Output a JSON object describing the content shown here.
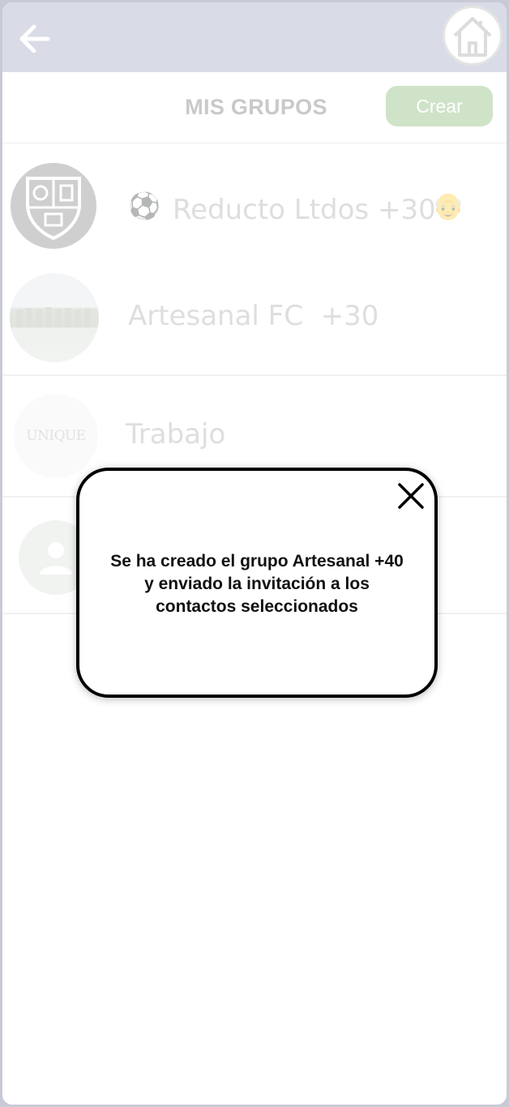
{
  "header": {
    "back_icon": "arrow-left-icon",
    "home_icon": "home-icon"
  },
  "title": "MIS GRUPOS",
  "create_button": "Crear",
  "groups": [
    {
      "name": "Reducto Ltdos +30",
      "leading_emoji": "⚽",
      "trailing_emoji": "👴",
      "avatar": "crest-logo"
    },
    {
      "name": "Artesanal FC  +30",
      "avatar": "team-photo"
    },
    {
      "name": "Trabajo",
      "avatar": "unique-logo",
      "avatar_text": "UNIQUE"
    },
    {
      "name": "",
      "avatar": "default-group-avatar"
    }
  ],
  "modal": {
    "message": "Se ha creado el grupo Artesanal +40 y enviado la invitación a los contactos seleccionados",
    "close_icon": "close-icon"
  },
  "colors": {
    "topbar": "#d9dce6",
    "create_button": "#cfe3c8",
    "modal_border": "#000000"
  }
}
